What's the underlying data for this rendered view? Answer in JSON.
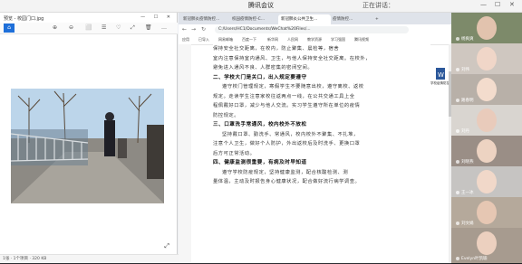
{
  "meeting": {
    "title": "腾讯会议",
    "sharing_status": "正在讲话：",
    "window_controls": [
      "—",
      "☐",
      "✕"
    ]
  },
  "viewer": {
    "title": "预览 - 校园门口.jpg",
    "toolbar": [
      "⌂",
      "⊕",
      "⊖",
      "⬜",
      "☰",
      "♡",
      "⤢",
      "🗑",
      "…"
    ],
    "status": "1张 · 1个项目 · 320 KB",
    "expand_icon": "⤢"
  },
  "browser": {
    "tabs": [
      {
        "label": "新冠肺炎疫情防控...",
        "active": false
      },
      {
        "label": "校园疫情防控-C...",
        "active": false
      },
      {
        "label": "新冠肺炎公共卫生...",
        "active": true
      },
      {
        "label": "疫情防控...",
        "active": false
      }
    ],
    "url": "C:/Users/HC1/Documents/WeChat%20Files/...",
    "bookmarks": [
      "应用",
      "已导入",
      "网易邮箱",
      "百度一下",
      "新华网",
      "人民网",
      "教学资源",
      "学习强国",
      "腾讯视频"
    ],
    "file_label": "学校疫情防控.docx"
  },
  "document": {
    "paragraphs": [
      {
        "type": "body",
        "text": "保持安全社交距离，在校内，防止聚集、晨检等，宿舍"
      },
      {
        "type": "body",
        "text": "室内注意保持室内通风、卫生，与他人保持安全社交距离。在校外，"
      },
      {
        "type": "body",
        "text": "避免进入通风不良、人群密集的密闭空间。"
      },
      {
        "type": "heading",
        "text": "二、学校大门是关口，出入规定要遵守"
      },
      {
        "type": "body-indent",
        "text": "遵守校门管理规定，寒假学生不要随意出校，遵守离校、返校"
      },
      {
        "type": "body",
        "text": "规定。走读学生注意家校往返两点一线，在公共交通工具上全"
      },
      {
        "type": "body",
        "text": "程佩戴好口罩，减少与他人交流。实习学生遵守所在单位的疫情"
      },
      {
        "type": "body",
        "text": "防控规定。"
      },
      {
        "type": "heading",
        "text": "三、口罩洗手常通风，校内校外不放松"
      },
      {
        "type": "body-indent",
        "text": "坚持戴口罩、勤洗手、常通风，校内校外不聚集、不扎堆，"
      },
      {
        "type": "body",
        "text": "注意个人卫生，做好个人防护，外出返校后及时洗手、更换口罩"
      },
      {
        "type": "body",
        "text": "后方可正常活动。"
      },
      {
        "type": "heading",
        "text": "四、健康监测很重要，有病及时早知道"
      },
      {
        "type": "body-indent",
        "text": "遵守学校防疫规定，坚持健康监测，配合核酸检测、测"
      },
      {
        "type": "body",
        "text": "量体温，主动及时报告身心健康状况，配合做好流行病学调查。"
      }
    ]
  },
  "participants": [
    {
      "name": "杨爽爽",
      "bg": "#7d8a6a",
      "face": "#e2c3ae"
    },
    {
      "name": "刘伟",
      "bg": "#cfc7c0",
      "face": "#f0d6c8"
    },
    {
      "name": "路春明",
      "bg": "#b8b0a8",
      "face": "#f3dccd"
    },
    {
      "name": "刘丹",
      "bg": "#d9d5d0",
      "face": "#e9cbbb"
    },
    {
      "name": "刘晓燕",
      "bg": "#9a8e86",
      "face": "#edd3c2"
    },
    {
      "name": "王一冰",
      "bg": "#c6c4c2",
      "face": "#f1d8c9"
    },
    {
      "name": "刘文娟",
      "bg": "#b5a99b",
      "face": "#e6c7b3"
    },
    {
      "name": "Evelyn叶凯瑜",
      "bg": "#a79b8f",
      "face": "#ecd0bf"
    }
  ]
}
